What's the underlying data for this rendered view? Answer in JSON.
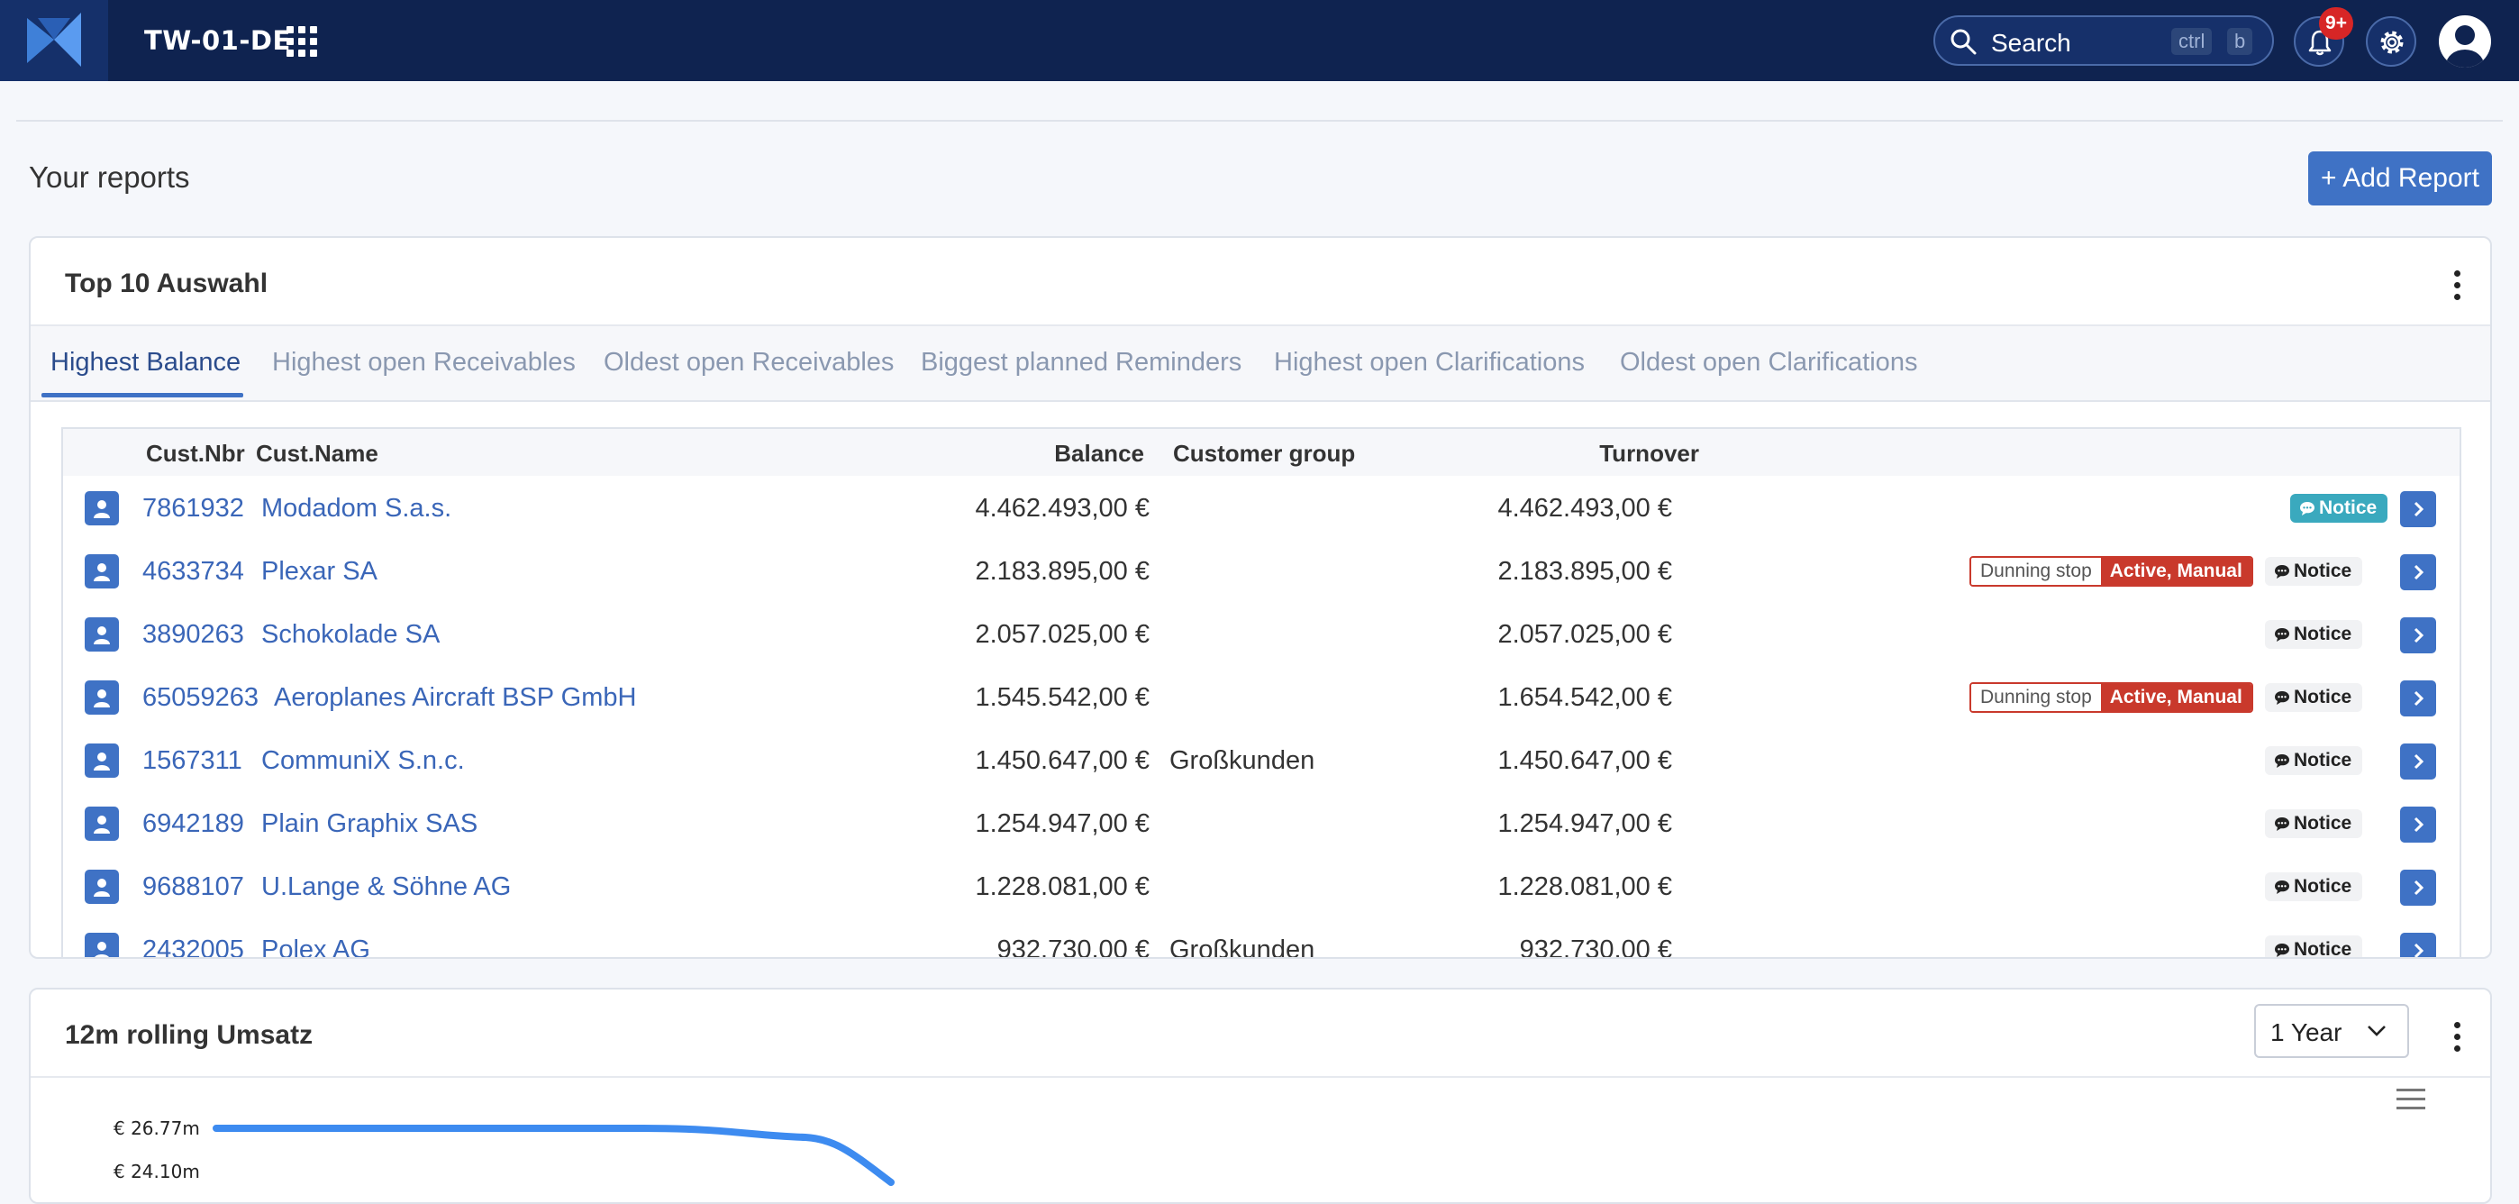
{
  "header": {
    "brand": "TW-01-DE",
    "search_label": "Search",
    "search_keys": [
      "ctrl",
      "b"
    ],
    "notification_count": "9+",
    "icons": [
      "logo",
      "apps-grid-icon",
      "search-icon",
      "bell-icon",
      "gear-icon",
      "user-icon"
    ]
  },
  "reports": {
    "title": "Your reports",
    "add_button": "+ Add Report"
  },
  "top10": {
    "title": "Top 10 Auswahl",
    "tabs": [
      {
        "label": "Highest Balance",
        "active": true
      },
      {
        "label": "Highest open Receivables",
        "active": false
      },
      {
        "label": "Oldest open Receivables",
        "active": false
      },
      {
        "label": "Biggest planned Reminders",
        "active": false
      },
      {
        "label": "Highest open Clarifications",
        "active": false
      },
      {
        "label": "Oldest open Clarifications",
        "active": false
      }
    ],
    "columns": {
      "nbr": "Cust.Nbr",
      "name": "Cust.Name",
      "balance": "Balance",
      "group": "Customer group",
      "turnover": "Turnover"
    },
    "notice_label": "Notice",
    "dunning_label": "Dunning stop",
    "dunning_value": "Active, Manual",
    "rows": [
      {
        "nbr": "7861932",
        "name": "Modadom S.a.s.",
        "balance": "4.462.493,00 €",
        "group": "",
        "turnover": "4.462.493,00 €",
        "dunning": false,
        "notice_style": "highlight"
      },
      {
        "nbr": "4633734",
        "name": "Plexar SA",
        "balance": "2.183.895,00 €",
        "group": "",
        "turnover": "2.183.895,00 €",
        "dunning": true,
        "notice_style": "plain"
      },
      {
        "nbr": "3890263",
        "name": "Schokolade SA",
        "balance": "2.057.025,00 €",
        "group": "",
        "turnover": "2.057.025,00 €",
        "dunning": false,
        "notice_style": "plain"
      },
      {
        "nbr": "65059263",
        "name": "Aeroplanes Aircraft BSP GmbH",
        "balance": "1.545.542,00 €",
        "group": "",
        "turnover": "1.654.542,00 €",
        "dunning": true,
        "notice_style": "plain"
      },
      {
        "nbr": "1567311",
        "name": "CommuniX S.n.c.",
        "balance": "1.450.647,00 €",
        "group": "Großkunden",
        "turnover": "1.450.647,00 €",
        "dunning": false,
        "notice_style": "plain"
      },
      {
        "nbr": "6942189",
        "name": "Plain Graphix SAS",
        "balance": "1.254.947,00 €",
        "group": "",
        "turnover": "1.254.947,00 €",
        "dunning": false,
        "notice_style": "plain"
      },
      {
        "nbr": "9688107",
        "name": "U.Lange & Söhne AG",
        "balance": "1.228.081,00 €",
        "group": "",
        "turnover": "1.228.081,00 €",
        "dunning": false,
        "notice_style": "plain"
      },
      {
        "nbr": "2432005",
        "name": "Polex AG",
        "balance": "932.730,00 €",
        "group": "Großkunden",
        "turnover": "932.730,00 €",
        "dunning": false,
        "notice_style": "plain"
      }
    ]
  },
  "rolling": {
    "title": "12m rolling Umsatz",
    "period": "1 Year",
    "y_ticks": [
      "€ 26.77m",
      "€ 24.10m"
    ]
  },
  "colors": {
    "header_bg": "#0f2350",
    "accent": "#3f72c5",
    "danger": "#c9392c",
    "notice_highlight": "#3aa9be",
    "link": "#3a66b8"
  }
}
